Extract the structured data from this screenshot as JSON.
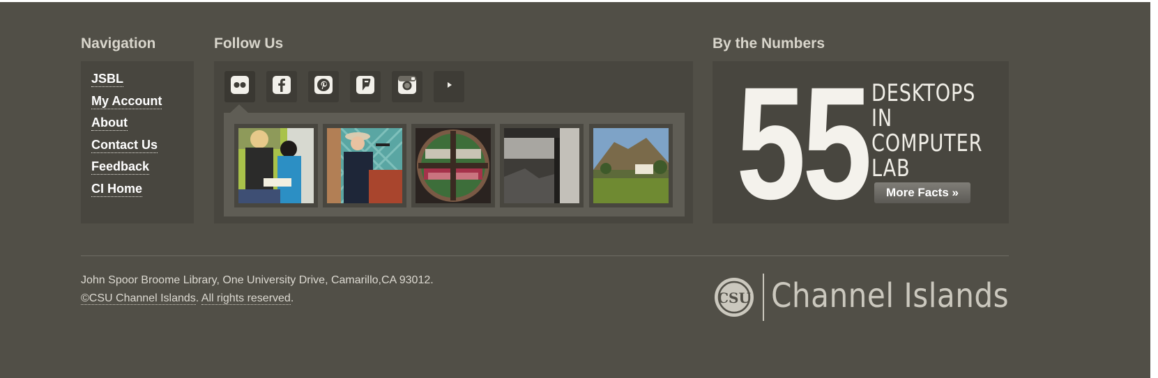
{
  "navigation": {
    "heading": "Navigation",
    "links": [
      "JSBL",
      "My Account",
      "About",
      "Contact Us",
      "Feedback",
      "CI Home"
    ]
  },
  "follow": {
    "heading": "Follow Us",
    "icons": [
      "flickr-icon",
      "facebook-icon",
      "pinterest-icon",
      "foursquare-icon",
      "instagram-icon",
      "youtube-icon"
    ],
    "photos": [
      "reading-photo",
      "speaker-photo",
      "window-view-photo",
      "historic-building-photo",
      "campus-hill-photo"
    ]
  },
  "numbers": {
    "heading": "By the Numbers",
    "value": "55",
    "caption_line1": "DESKTOPS IN",
    "caption_line2": "COMPUTER",
    "caption_line3": "LAB",
    "button": "More Facts »"
  },
  "footer": {
    "address": "John Spoor Broome Library, One University Drive, Camarillo,CA 93012.",
    "copyright_owner": "©CSU Channel Islands",
    "copyright_sep": ". ",
    "copyright_rights": "All rights reserved",
    "copyright_end": ".",
    "logo_mark": "CSU",
    "logo_text": "Channel Islands"
  },
  "colors": {
    "background": "#514f47",
    "panel": "#48463f",
    "heading": "#d9d6cc"
  }
}
